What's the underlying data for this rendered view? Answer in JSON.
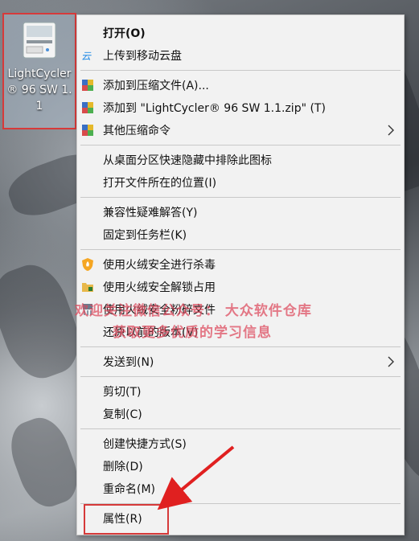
{
  "desktop": {
    "icon_label": "LightCycler® 96 SW 1.1"
  },
  "menu": {
    "items": [
      {
        "label": "打开(O)",
        "bold": true
      },
      {
        "label": "上传到移动云盘",
        "icon": "cloud-icon"
      },
      {
        "label": "添加到压缩文件(A)...",
        "icon": "archive-icon"
      },
      {
        "label": "添加到 \"LightCycler® 96 SW 1.1.zip\" (T)",
        "icon": "archive-icon"
      },
      {
        "label": "其他压缩命令",
        "icon": "archive-icon",
        "submenu": true
      },
      {
        "label": "从桌面分区快速隐藏中排除此图标"
      },
      {
        "label": "打开文件所在的位置(I)"
      },
      {
        "label": "兼容性疑难解答(Y)"
      },
      {
        "label": "固定到任务栏(K)"
      },
      {
        "label": "使用火绒安全进行杀毒",
        "icon": "huorong-shield-icon"
      },
      {
        "label": "使用火绒安全解锁占用",
        "icon": "folder-lock-icon"
      },
      {
        "label": "使用火绒安全粉碎文件",
        "icon": "shred-icon"
      },
      {
        "label": "还原以前的版本(V)"
      },
      {
        "label": "发送到(N)",
        "submenu": true
      },
      {
        "label": "剪切(T)"
      },
      {
        "label": "复制(C)"
      },
      {
        "label": "创建快捷方式(S)"
      },
      {
        "label": "删除(D)"
      },
      {
        "label": "重命名(M)"
      },
      {
        "label": "属性(R)"
      }
    ]
  },
  "watermark": {
    "line1": "欢迎关注微信公众号： 大众软件仓库",
    "line2": "获取更多优质的学习信息",
    "seal_chars": [
      "软",
      "件"
    ]
  },
  "colors": {
    "highlight": "#d63a3a",
    "menu_bg": "#f2f2f2",
    "watermark": "#dc465a"
  }
}
